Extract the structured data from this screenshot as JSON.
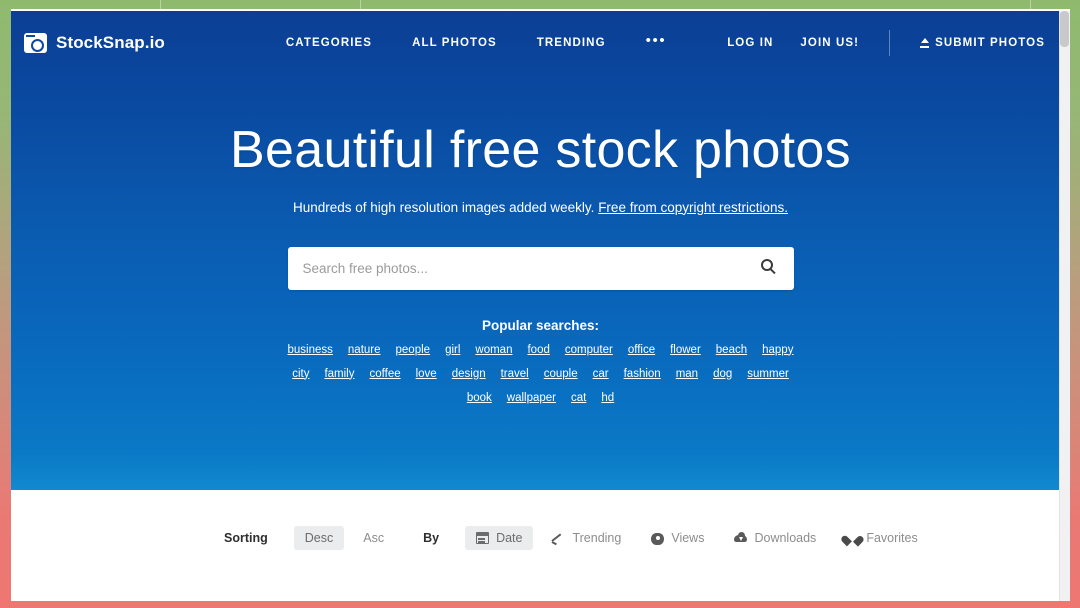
{
  "brand": {
    "name": "StockSnap.io",
    "icon": "camera-icon"
  },
  "nav": {
    "center_links": [
      {
        "label": "CATEGORIES",
        "name": "categories"
      },
      {
        "label": "ALL PHOTOS",
        "name": "all-photos"
      },
      {
        "label": "TRENDING",
        "name": "trending"
      }
    ],
    "more_label": "•••",
    "right_links": [
      {
        "label": "LOG IN",
        "name": "log-in"
      },
      {
        "label": "JOIN US!",
        "name": "join-us"
      }
    ],
    "submit": {
      "label": "SUBMIT PHOTOS",
      "icon": "upload-icon"
    }
  },
  "hero": {
    "headline": "Beautiful free stock photos",
    "subhead_text": "Hundreds of high resolution images added weekly. ",
    "subhead_link": "Free from copyright restrictions.",
    "search": {
      "placeholder": "Search free photos...",
      "value": "",
      "icon": "search-icon"
    },
    "popular": {
      "title": "Popular searches:",
      "rows": [
        [
          "business",
          "nature",
          "people",
          "girl",
          "woman",
          "food",
          "computer",
          "office",
          "flower",
          "beach",
          "happy"
        ],
        [
          "city",
          "family",
          "coffee",
          "love",
          "design",
          "travel",
          "couple",
          "car",
          "fashion",
          "man",
          "dog",
          "summer"
        ],
        [
          "book",
          "wallpaper",
          "cat",
          "hd"
        ]
      ]
    }
  },
  "sorting": {
    "sorting_label": "Sorting",
    "desc_label": "Desc",
    "asc_label": "Asc",
    "by_label": "By",
    "date_label": "Date",
    "trending_label": "Trending",
    "views_label": "Views",
    "downloads_label": "Downloads",
    "favorites_label": "Favorites",
    "active_direction": "Desc",
    "active_field": "Date"
  },
  "colors": {
    "hero_gradient_top": "#0b3f95",
    "hero_gradient_bottom": "#1189cf",
    "frame_top": "#8fba6e",
    "frame_bottom": "#ee7772",
    "chip_active_bg": "#ebeced"
  }
}
